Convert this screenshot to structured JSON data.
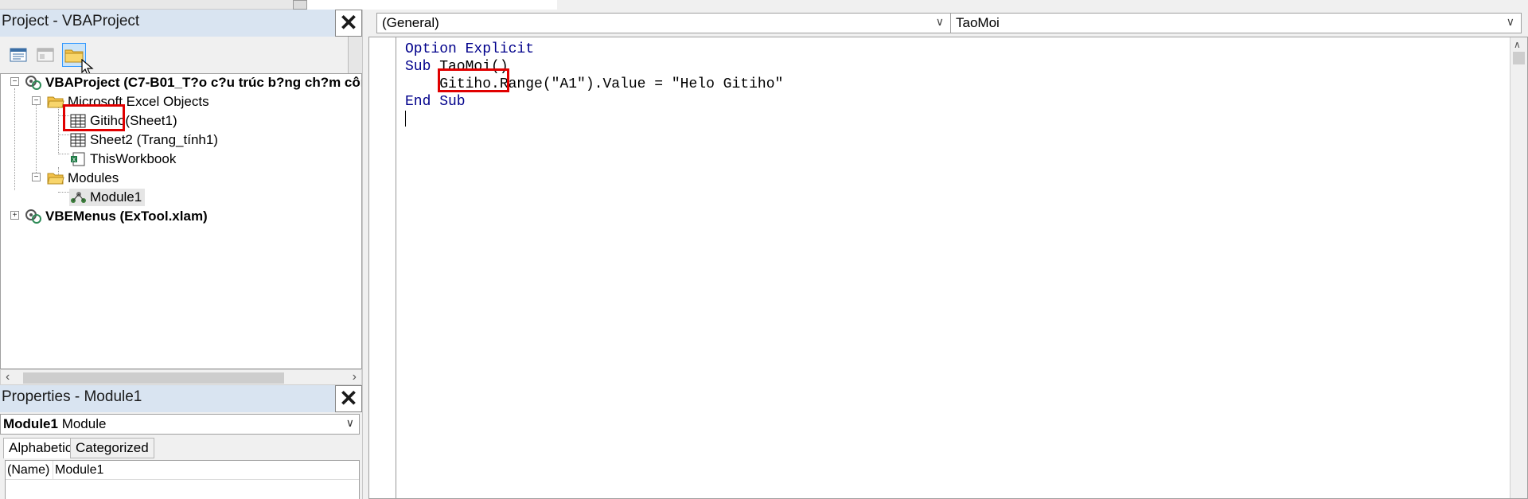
{
  "project": {
    "title": "Project - VBAProject",
    "tree": {
      "root1": "VBAProject (C7-B01_T?o c?u trúc b?ng ch?m côn",
      "folder_objects": "Microsoft Excel Objects",
      "sheet1_name": "Gitiho",
      "sheet1_suffix": " (Sheet1)",
      "sheet2": "Sheet2 (Trang_tính1)",
      "workbook": "ThisWorkbook",
      "folder_modules": "Modules",
      "module1": "Module1",
      "root2": "VBEMenus (ExTool.xlam)"
    }
  },
  "properties": {
    "title": "Properties - Module1",
    "object_name": "Module1",
    "object_type": "Module",
    "tabs": [
      "Alphabetic",
      "Categorized"
    ],
    "rows": [
      {
        "key": "(Name)",
        "value": "Module1"
      }
    ]
  },
  "code": {
    "object_combo": "(General)",
    "proc_combo": "TaoMoi",
    "line1_kw": "Option Explicit",
    "line2_kw": "Sub",
    "line2_rest": " TaoMoi()",
    "line3_indent": "    ",
    "line3_obj": "Gitiho",
    "line3_rest": ".Range(\"A1\").Value = \"Helo Gitiho\"",
    "line4_kw": "End Sub"
  },
  "colors": {
    "keyword": "#00008b",
    "highlight_box": "#e00000",
    "title_bar": "#d9e4f1"
  }
}
